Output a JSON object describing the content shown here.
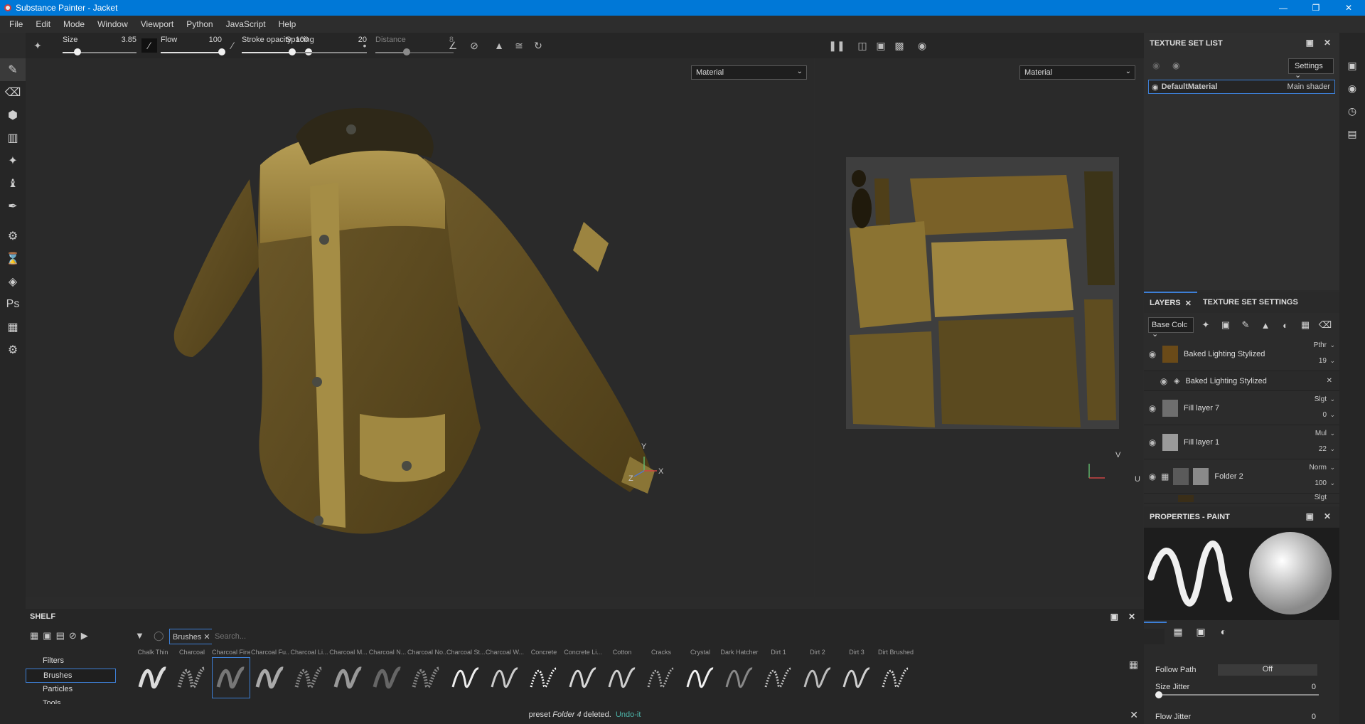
{
  "window": {
    "title": "Substance Painter - Jacket",
    "controls": [
      "minimize",
      "restore",
      "close"
    ]
  },
  "menu": [
    "File",
    "Edit",
    "Mode",
    "Window",
    "Viewport",
    "Python",
    "JavaScript",
    "Help"
  ],
  "tool_options": {
    "size": {
      "label": "Size",
      "value": "3.85",
      "fraction": 0.2
    },
    "flow": {
      "label": "Flow",
      "value": "100",
      "fraction": 1.0
    },
    "stroke_opacity": {
      "label": "Stroke opacity",
      "value": "100",
      "fraction": 1.0
    },
    "spacing": {
      "label": "Spacing",
      "value": "20",
      "fraction": 0.08
    },
    "distance": {
      "label": "Distance",
      "value": "8",
      "fraction": 0.4
    }
  },
  "viewport3d": {
    "mode": "Material",
    "axes": [
      "Y",
      "Z",
      "X"
    ]
  },
  "viewport2d": {
    "mode": "Material",
    "axes": [
      "V",
      "U"
    ]
  },
  "texture_set_list": {
    "title": "TEXTURE SET LIST",
    "settings_label": "Settings",
    "items": [
      {
        "name": "DefaultMaterial",
        "shader": "Main shader"
      }
    ]
  },
  "layers": {
    "tab_layers": "LAYERS",
    "tab_texture_settings": "TEXTURE SET SETTINGS",
    "channel": "Base Colc",
    "rows": [
      {
        "name": "Baked Lighting Stylized",
        "blend": "Pthr",
        "opacity": "19"
      },
      {
        "name": "Baked Lighting Stylized",
        "sub": true
      },
      {
        "name": "Fill layer 7",
        "blend": "Slgt",
        "opacity": "0"
      },
      {
        "name": "Fill layer 1",
        "blend": "Mul",
        "opacity": "22"
      },
      {
        "name": "Folder 2",
        "blend": "Norm",
        "opacity": "100"
      },
      {
        "name": "",
        "blend": "Slgt",
        "opacity": ""
      }
    ]
  },
  "properties": {
    "title": "PROPERTIES - PAINT",
    "follow_path": {
      "label": "Follow Path",
      "value": "Off"
    },
    "size_jitter": {
      "label": "Size Jitter",
      "value": "0"
    },
    "flow_jitter": {
      "label": "Flow Jitter",
      "value": "0"
    }
  },
  "shelf": {
    "title": "SHELF",
    "filter_tag": "Brushes",
    "search_placeholder": "Search...",
    "categories": [
      "Filters",
      "Brushes",
      "Particles",
      "Tools"
    ],
    "active_category": "Brushes",
    "brushes": [
      "Chalk Thin",
      "Charcoal",
      "Charcoal Fine",
      "Charcoal Fu...",
      "Charcoal Li...",
      "Charcoal M...",
      "Charcoal N...",
      "Charcoal No...",
      "Charcoal St...",
      "Charcoal W...",
      "Concrete",
      "Concrete Li...",
      "Cotton",
      "Cracks",
      "Crystal",
      "Dark Hatcher",
      "Dirt 1",
      "Dirt 2",
      "Dirt 3",
      "Dirt Brushed"
    ]
  },
  "status": {
    "message_prefix": "preset",
    "message_item": "Folder 4",
    "message_suffix": "deleted.",
    "link": "Undo-it"
  }
}
